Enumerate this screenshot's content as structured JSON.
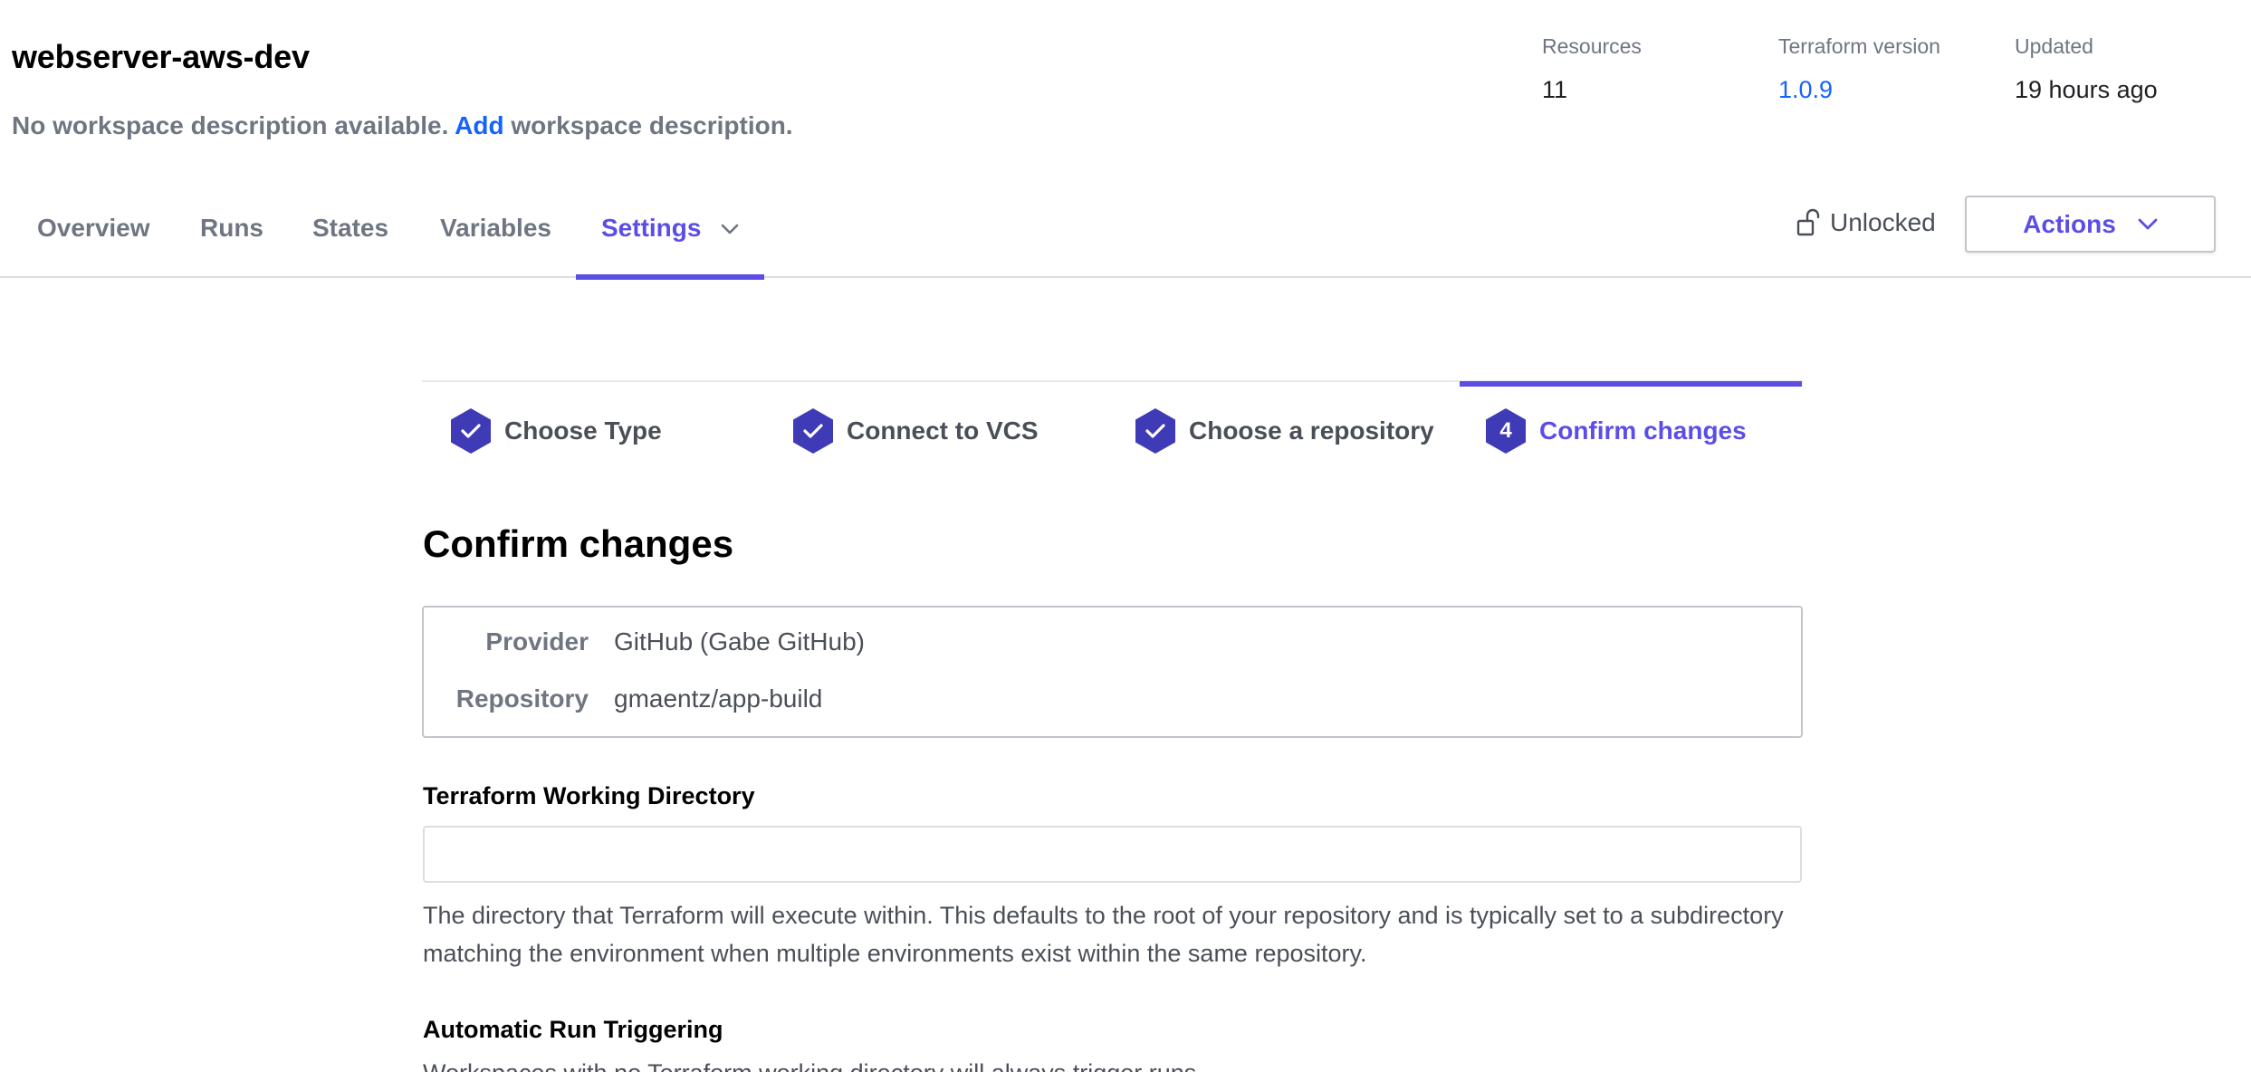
{
  "workspace": {
    "name": "webserver-aws-dev",
    "description_prefix": "No workspace description available.",
    "description_link": "Add",
    "description_suffix": "workspace description."
  },
  "meta": {
    "resources_label": "Resources",
    "resources_value": "11",
    "tf_version_label": "Terraform version",
    "tf_version_value": "1.0.9",
    "updated_label": "Updated",
    "updated_value": "19 hours ago"
  },
  "tabs": [
    {
      "label": "Overview"
    },
    {
      "label": "Runs"
    },
    {
      "label": "States"
    },
    {
      "label": "Variables"
    },
    {
      "label": "Settings",
      "active": true
    }
  ],
  "lock_status": "Unlocked",
  "actions_label": "Actions",
  "steps": [
    {
      "label": "Choose Type",
      "done": true
    },
    {
      "label": "Connect to VCS",
      "done": true
    },
    {
      "label": "Choose a repository",
      "done": true
    },
    {
      "label": "Confirm changes",
      "number": "4",
      "active": true
    }
  ],
  "content": {
    "title": "Confirm changes",
    "provider_label": "Provider",
    "provider_value": "GitHub (Gabe GitHub)",
    "repository_label": "Repository",
    "repository_value": "gmaentz/app-build",
    "working_dir_label": "Terraform Working Directory",
    "working_dir_value": "",
    "working_dir_help": "The directory that Terraform will execute within. This defaults to the root of your repository and is typically set to a subdirectory matching the environment when multiple environments exist within the same repository.",
    "auto_run_label": "Automatic Run Triggering",
    "auto_run_help_partial": "Workspaces with no Terraform working directory will always trigger runs."
  },
  "colors": {
    "accent": "#5c4ee5",
    "link": "#1563ff",
    "check_hex": "#3f3bb7",
    "muted_text": "#6f7682"
  }
}
